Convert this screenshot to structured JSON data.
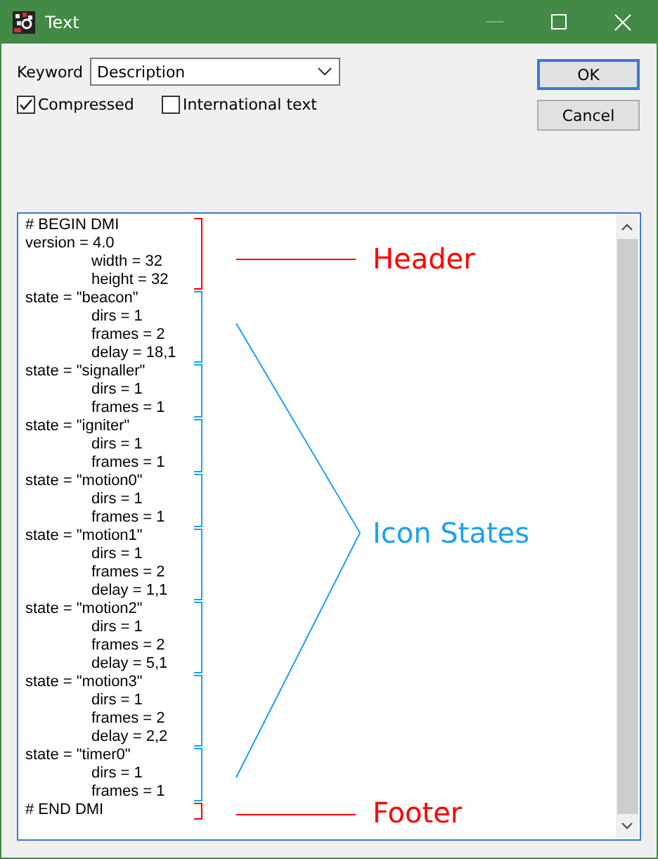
{
  "window": {
    "title": "Text"
  },
  "keyword": {
    "label": "Keyword",
    "value": "Description"
  },
  "options": [
    {
      "label": "Compressed",
      "checked": true
    },
    {
      "label": "International text",
      "checked": false
    }
  ],
  "buttons": [
    {
      "label": "OK",
      "selected": true
    },
    {
      "label": "Cancel",
      "selected": false
    }
  ],
  "groups": [
    {
      "kind": "header",
      "lines": [
        {
          "text": "# BEGIN DMI"
        },
        {
          "text": "version = 4.0",
          "children": [
            {
              "text": "width = 32"
            },
            {
              "text": "height = 32"
            }
          ]
        }
      ]
    },
    {
      "kind": "state",
      "lines": [
        {
          "text": "state = \"beacon\"",
          "children": [
            {
              "text": "dirs = 1"
            },
            {
              "text": "frames = 2"
            },
            {
              "text": "delay = 18,1"
            }
          ]
        }
      ]
    },
    {
      "kind": "state",
      "lines": [
        {
          "text": "state = \"signaller\"",
          "children": [
            {
              "text": "dirs = 1"
            },
            {
              "text": "frames = 1"
            }
          ]
        }
      ]
    },
    {
      "kind": "state",
      "lines": [
        {
          "text": "state = \"igniter\"",
          "children": [
            {
              "text": "dirs = 1"
            },
            {
              "text": "frames = 1"
            }
          ]
        }
      ]
    },
    {
      "kind": "state",
      "lines": [
        {
          "text": "state = \"motion0\"",
          "children": [
            {
              "text": "dirs = 1"
            },
            {
              "text": "frames = 1"
            }
          ]
        }
      ]
    },
    {
      "kind": "state",
      "lines": [
        {
          "text": "state = \"motion1\"",
          "children": [
            {
              "text": "dirs = 1"
            },
            {
              "text": "frames = 2"
            },
            {
              "text": "delay = 1,1"
            }
          ]
        }
      ]
    },
    {
      "kind": "state",
      "lines": [
        {
          "text": "state = \"motion2\"",
          "children": [
            {
              "text": "dirs = 1"
            },
            {
              "text": "frames = 2"
            },
            {
              "text": "delay = 5,1"
            }
          ]
        }
      ]
    },
    {
      "kind": "state",
      "lines": [
        {
          "text": "state = \"motion3\"",
          "children": [
            {
              "text": "dirs = 1"
            },
            {
              "text": "frames = 2"
            },
            {
              "text": "delay = 2,2"
            }
          ]
        }
      ]
    },
    {
      "kind": "state",
      "lines": [
        {
          "text": "state = \"timer0\"",
          "children": [
            {
              "text": "dirs = 1"
            },
            {
              "text": "frames = 1"
            }
          ]
        }
      ]
    },
    {
      "kind": "footer",
      "lines": [
        {
          "text": "# END DMI"
        }
      ]
    }
  ],
  "annotations": [
    {
      "kind": "single",
      "label": "Header",
      "color": "#ff0000"
    },
    {
      "kind": "fan",
      "label": "Icon States",
      "color": "#1ba1f2"
    },
    {
      "kind": "single",
      "label": "Footer",
      "color": "#ff0000"
    }
  ]
}
